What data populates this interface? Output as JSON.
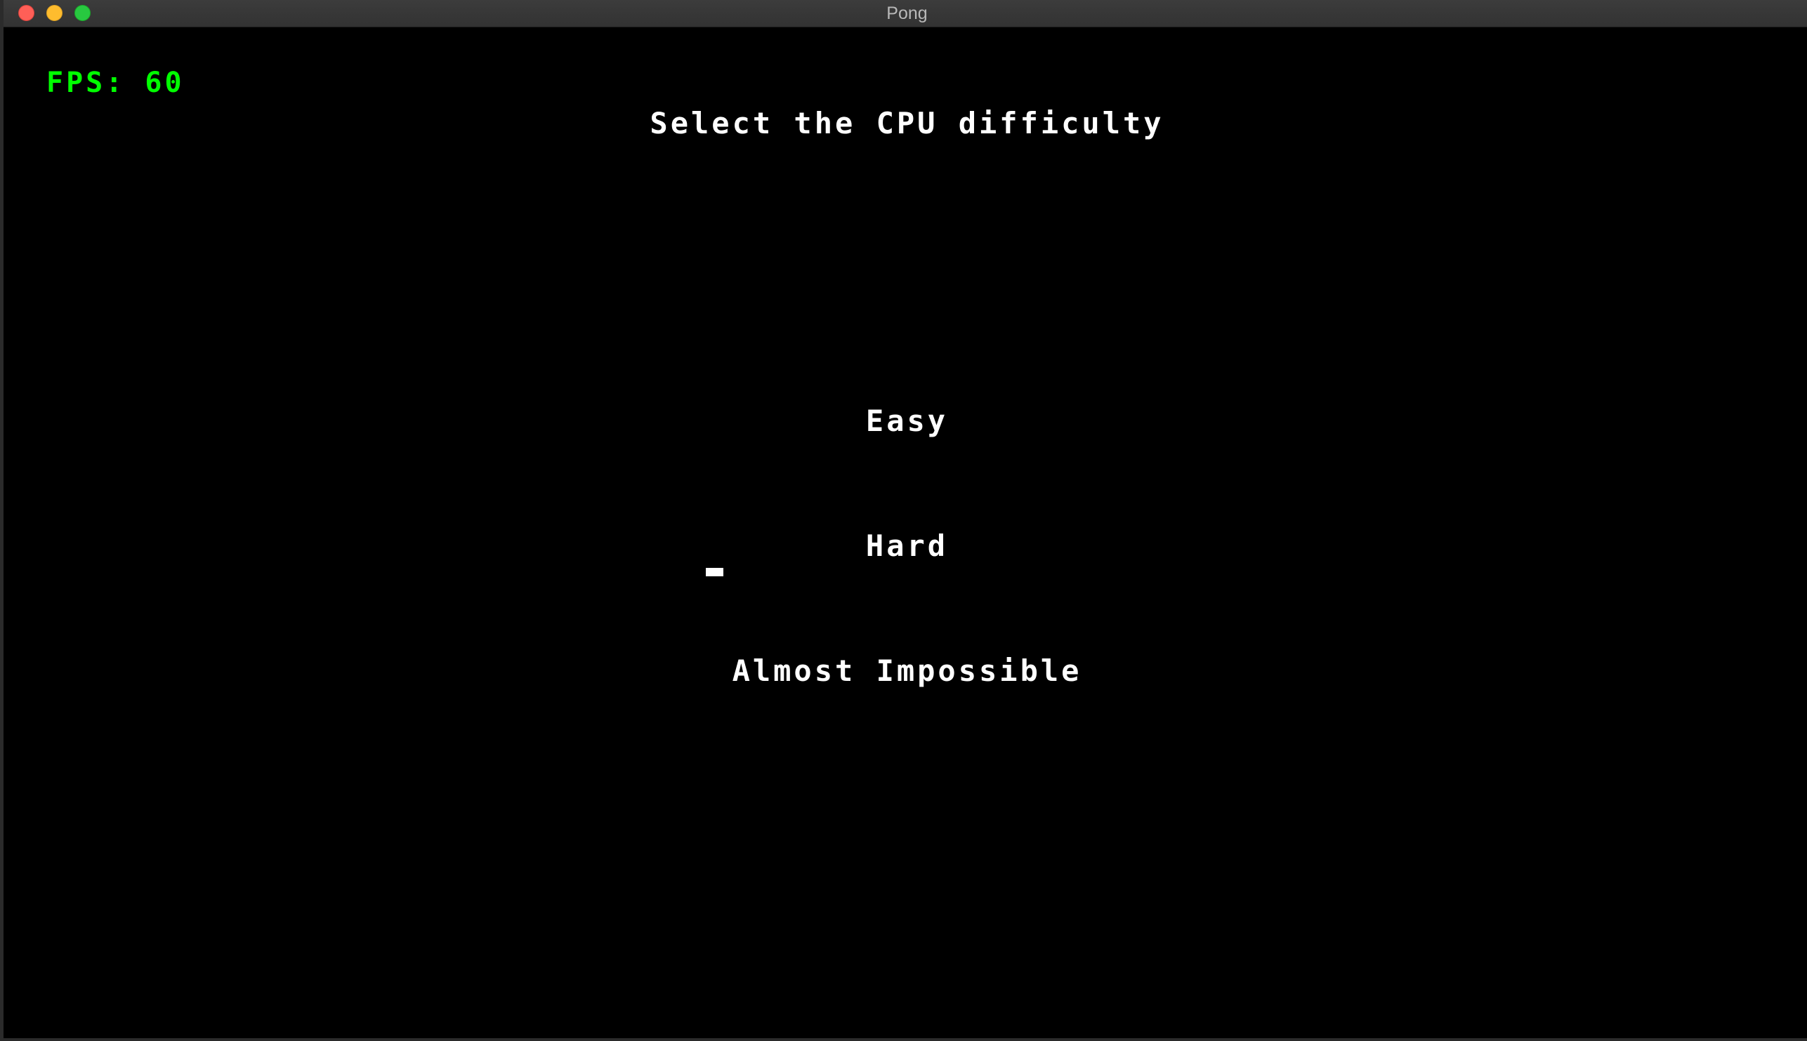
{
  "window": {
    "title": "Pong"
  },
  "hud": {
    "fps_label": "FPS: 60"
  },
  "menu": {
    "heading": "Select the CPU difficulty",
    "options": [
      {
        "label": "Easy"
      },
      {
        "label": "Hard"
      },
      {
        "label": "Almost Impossible"
      }
    ],
    "selected_option": "Hard"
  },
  "colors": {
    "background": "#000000",
    "text": "#ffffff",
    "fps": "#00ff00"
  }
}
